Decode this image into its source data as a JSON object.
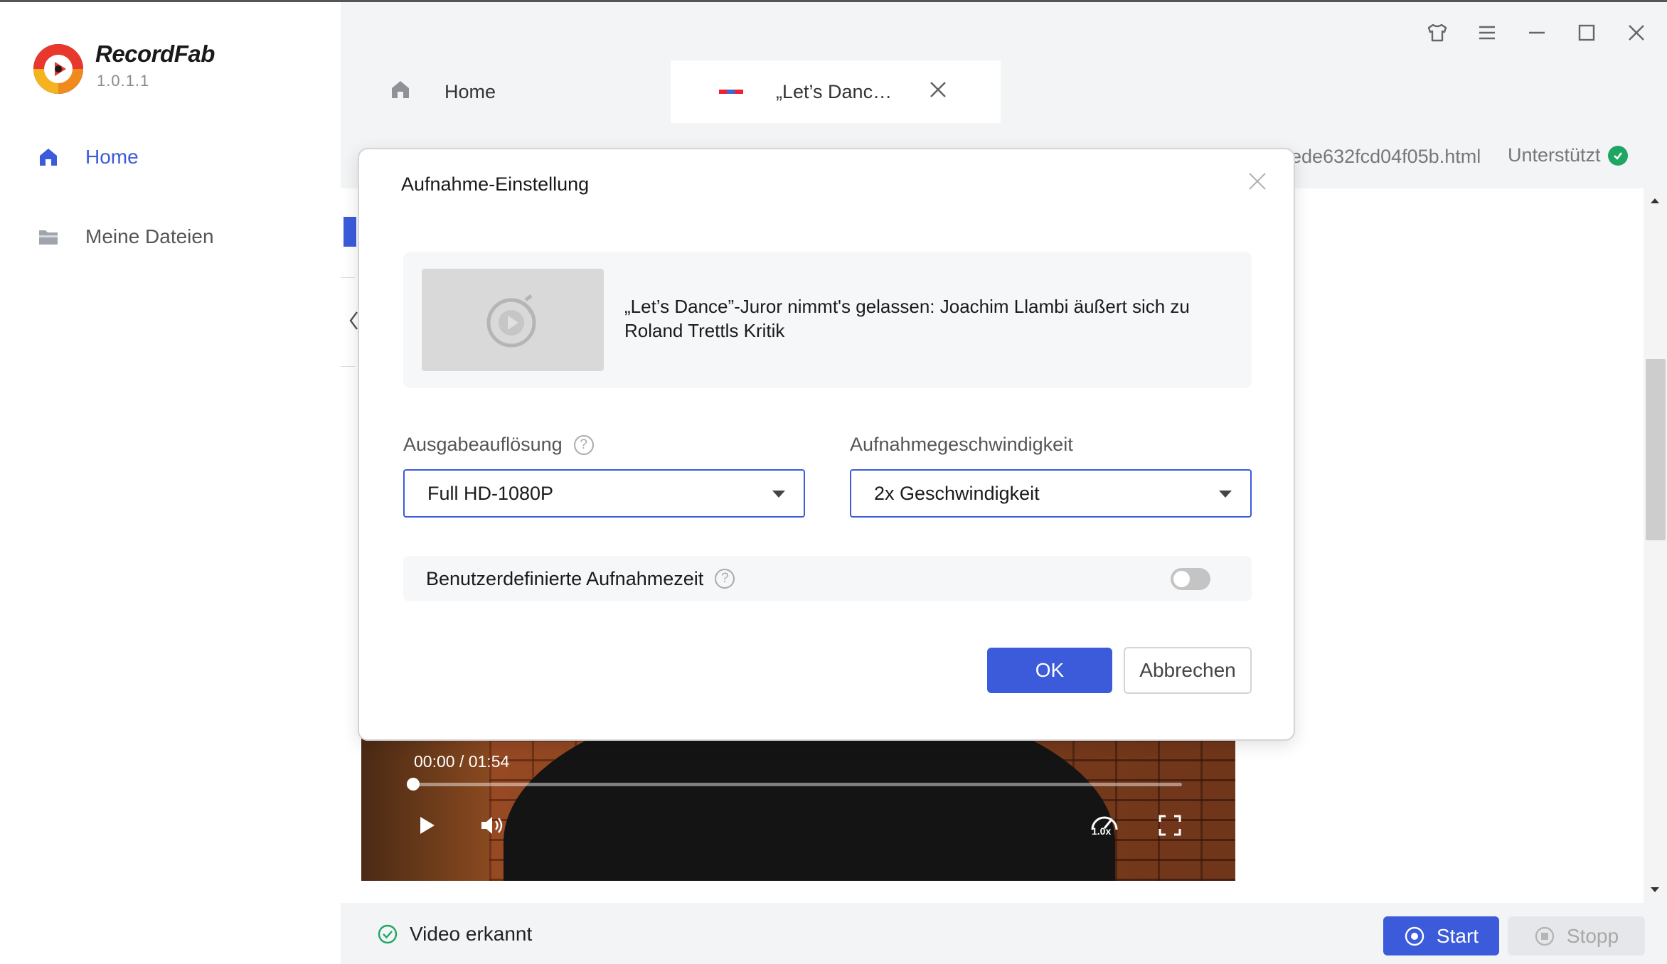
{
  "app": {
    "name": "RecordFab",
    "version": "1.0.1.1"
  },
  "sidebar": {
    "items": [
      {
        "label": "Home",
        "icon": "home-icon",
        "active": true
      },
      {
        "label": "Meine Dateien",
        "icon": "folder-icon",
        "active": false
      }
    ]
  },
  "tabs": [
    {
      "label": "Home",
      "icon": "home-icon"
    },
    {
      "label": "„Let’s Dance”-Juror nimmt's gelassen",
      "icon": "site-favicon",
      "active": true
    }
  ],
  "urlbar": {
    "url_fragment": "ede632fcd04f05b.html",
    "support_label": "Unterstützt"
  },
  "player": {
    "time": "00:00 / 01:54",
    "progress": 0,
    "speed_badge": "1.0x"
  },
  "status": {
    "detected": "Video erkannt"
  },
  "actions": {
    "start": "Start",
    "stop": "Stopp"
  },
  "dialog": {
    "title": "Aufnahme-Einstellung",
    "video_title": "„Let’s Dance”-Juror nimmt's gelassen: Joachim Llambi äußert sich zu Roland Trettls Kritik",
    "resolution_label": "Ausgabeauflösung",
    "resolution_value": "Full HD-1080P",
    "speed_label": "Aufnahmegeschwindigkeit",
    "speed_value": "2x Geschwindigkeit",
    "custom_time_label": "Benutzerdefinierte Aufnahmezeit",
    "custom_time_enabled": false,
    "ok": "OK",
    "cancel": "Abbrechen"
  },
  "colors": {
    "accent": "#3b5bdb",
    "success": "#1fa663"
  }
}
